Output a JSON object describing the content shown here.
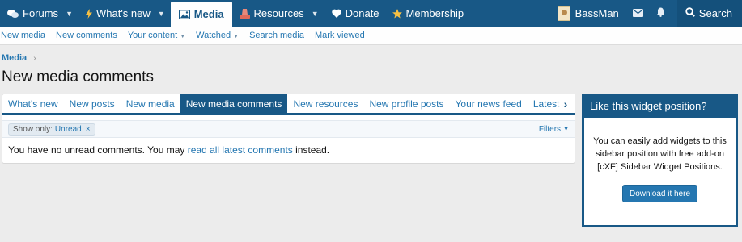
{
  "topnav": {
    "tabs": [
      {
        "label": "Forums",
        "icon": "chat-bubbles-icon",
        "has_dropdown": true
      },
      {
        "label": "What's new",
        "icon": "bolt-icon",
        "has_dropdown": true
      },
      {
        "label": "Media",
        "icon": "image-icon",
        "has_dropdown": false,
        "active": true
      },
      {
        "label": "Resources",
        "icon": "resources-icon",
        "has_dropdown": true
      },
      {
        "label": "Donate",
        "icon": "heart-icon",
        "has_dropdown": false
      },
      {
        "label": "Membership",
        "icon": "star-icon",
        "has_dropdown": false
      }
    ],
    "user": {
      "name": "BassMan"
    },
    "search_label": "Search"
  },
  "subnav": {
    "links": [
      {
        "label": "New media",
        "has_dropdown": false
      },
      {
        "label": "New comments",
        "has_dropdown": false
      },
      {
        "label": "Your content",
        "has_dropdown": true
      },
      {
        "label": "Watched",
        "has_dropdown": true
      },
      {
        "label": "Search media",
        "has_dropdown": false
      },
      {
        "label": "Mark viewed",
        "has_dropdown": false
      }
    ]
  },
  "breadcrumb": {
    "items": [
      "Media"
    ]
  },
  "page_title": "New media comments",
  "tabs": {
    "items": [
      {
        "label": "What's new",
        "active": false
      },
      {
        "label": "New posts",
        "active": false
      },
      {
        "label": "New media",
        "active": false
      },
      {
        "label": "New media comments",
        "active": true
      },
      {
        "label": "New resources",
        "active": false
      },
      {
        "label": "New profile posts",
        "active": false
      },
      {
        "label": "Your news feed",
        "active": false
      },
      {
        "label": "Latest activity",
        "active": false
      }
    ]
  },
  "filter": {
    "prefix": "Show only:",
    "value": "Unread",
    "remove_symbol": "×",
    "filters_label": "Filters"
  },
  "empty_message": {
    "before": "You have no unread comments. You may ",
    "link": "read all latest comments",
    "after": " instead."
  },
  "widget": {
    "title": "Like this widget position?",
    "body": "You can easily add widgets to this sidebar position with free add-on [cXF] Sidebar Widget Positions.",
    "button_label": "Download it here"
  },
  "colors": {
    "nav_bg": "#185886",
    "link": "#2577b1",
    "page_bg": "#ececec"
  }
}
